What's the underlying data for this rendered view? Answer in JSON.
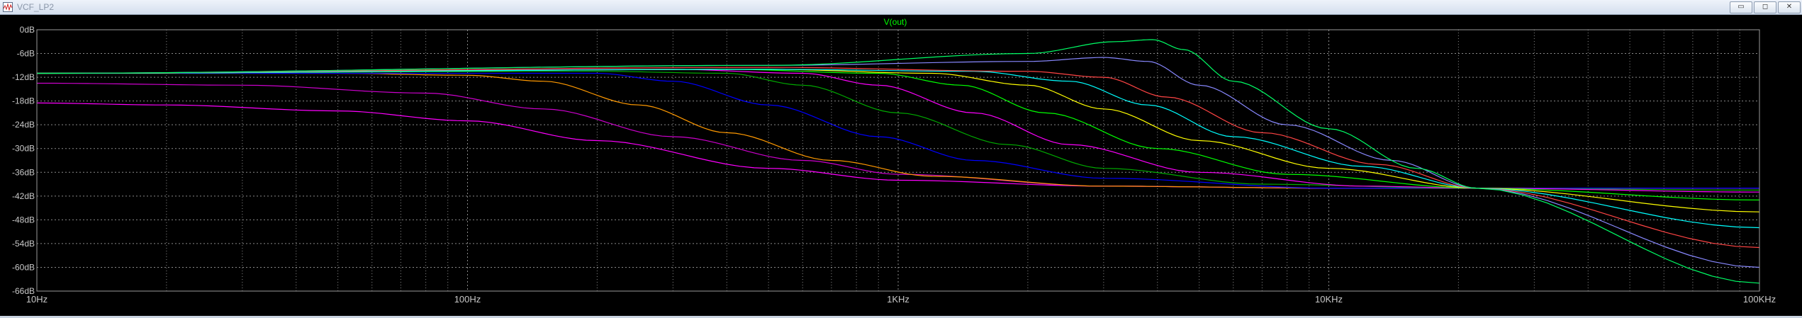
{
  "window": {
    "title": "VCF_LP2",
    "buttons": {
      "minimize": "▭",
      "maximize": "◻",
      "close": "✕"
    }
  },
  "plot": {
    "trace_label": "V(out)",
    "trace_label_color": "#00ff00",
    "background": "#000000",
    "grid_color": "#8a8a8a",
    "axis_text_color": "#c8c8c8"
  },
  "chart_data": {
    "type": "line",
    "title": "V(out)",
    "x_scale": "log",
    "xlim": [
      10,
      100000
    ],
    "ylim": [
      -66,
      0
    ],
    "grid": true,
    "x_ticks": [
      {
        "value": 10,
        "label": "10Hz"
      },
      {
        "value": 100,
        "label": "100Hz"
      },
      {
        "value": 1000,
        "label": "1KHz"
      },
      {
        "value": 10000,
        "label": "10KHz"
      },
      {
        "value": 100000,
        "label": "100KHz"
      }
    ],
    "y_ticks": [
      {
        "value": 0,
        "label": "0dB"
      },
      {
        "value": -6,
        "label": "-6dB"
      },
      {
        "value": -12,
        "label": "-12dB"
      },
      {
        "value": -18,
        "label": "-18dB"
      },
      {
        "value": -24,
        "label": "-24dB"
      },
      {
        "value": -30,
        "label": "-30dB"
      },
      {
        "value": -36,
        "label": "-36dB"
      },
      {
        "value": -42,
        "label": "-42dB"
      },
      {
        "value": -48,
        "label": "-48dB"
      },
      {
        "value": -54,
        "label": "-54dB"
      },
      {
        "value": -60,
        "label": "-60dB"
      },
      {
        "value": -66,
        "label": "-66dB"
      }
    ],
    "series": [
      {
        "color": "#ff00ff",
        "points": [
          [
            10,
            -18.5
          ],
          [
            20,
            -19
          ],
          [
            50,
            -20.5
          ],
          [
            100,
            -23
          ],
          [
            200,
            -28
          ],
          [
            500,
            -35
          ],
          [
            1000,
            -38
          ],
          [
            3000,
            -39.5
          ],
          [
            10000,
            -40
          ],
          [
            100000,
            -40
          ]
        ]
      },
      {
        "color": "#cc00cc",
        "points": [
          [
            10,
            -13.5
          ],
          [
            30,
            -14
          ],
          [
            80,
            -16
          ],
          [
            150,
            -20
          ],
          [
            300,
            -27
          ],
          [
            600,
            -33
          ],
          [
            1000,
            -36.5
          ],
          [
            3000,
            -39.5
          ],
          [
            10000,
            -40
          ],
          [
            100000,
            -40
          ]
        ]
      },
      {
        "color": "#ff9900",
        "points": [
          [
            10,
            -11
          ],
          [
            50,
            -11
          ],
          [
            100,
            -11.5
          ],
          [
            150,
            -13
          ],
          [
            250,
            -19
          ],
          [
            400,
            -26
          ],
          [
            700,
            -33
          ],
          [
            1200,
            -37
          ],
          [
            3000,
            -39.5
          ],
          [
            10000,
            -40
          ],
          [
            100000,
            -40
          ]
        ]
      },
      {
        "color": "#0000ff",
        "points": [
          [
            10,
            -11
          ],
          [
            100,
            -11
          ],
          [
            200,
            -11
          ],
          [
            300,
            -13
          ],
          [
            500,
            -19
          ],
          [
            900,
            -27
          ],
          [
            1500,
            -33
          ],
          [
            3000,
            -37.5
          ],
          [
            10000,
            -40
          ],
          [
            100000,
            -40
          ]
        ]
      },
      {
        "color": "#00aa00",
        "points": [
          [
            10,
            -11
          ],
          [
            200,
            -10.5
          ],
          [
            400,
            -11
          ],
          [
            600,
            -14
          ],
          [
            1000,
            -21
          ],
          [
            1800,
            -29
          ],
          [
            3000,
            -35
          ],
          [
            7000,
            -39
          ],
          [
            20000,
            -40
          ],
          [
            100000,
            -40.5
          ]
        ]
      },
      {
        "color": "#ff00ff",
        "points": [
          [
            10,
            -11
          ],
          [
            300,
            -10
          ],
          [
            600,
            -11
          ],
          [
            900,
            -14
          ],
          [
            1500,
            -21
          ],
          [
            2500,
            -29
          ],
          [
            5000,
            -36
          ],
          [
            12000,
            -39.5
          ],
          [
            22000,
            -40
          ],
          [
            100000,
            -41
          ]
        ]
      },
      {
        "color": "#00ff00",
        "points": [
          [
            10,
            -11
          ],
          [
            400,
            -10
          ],
          [
            900,
            -11
          ],
          [
            1400,
            -14
          ],
          [
            2200,
            -21
          ],
          [
            4000,
            -30
          ],
          [
            8000,
            -36.5
          ],
          [
            22000,
            -40
          ],
          [
            100000,
            -43
          ]
        ]
      },
      {
        "color": "#ffff00",
        "points": [
          [
            10,
            -11
          ],
          [
            500,
            -10
          ],
          [
            1200,
            -11
          ],
          [
            2000,
            -14
          ],
          [
            3000,
            -20
          ],
          [
            5000,
            -28
          ],
          [
            10000,
            -35
          ],
          [
            22000,
            -40
          ],
          [
            100000,
            -46
          ]
        ]
      },
      {
        "color": "#00ffff",
        "points": [
          [
            10,
            -11
          ],
          [
            500,
            -10
          ],
          [
            1500,
            -10.5
          ],
          [
            2500,
            -13
          ],
          [
            3800,
            -19
          ],
          [
            6000,
            -27
          ],
          [
            12000,
            -34.5
          ],
          [
            22000,
            -40
          ],
          [
            100000,
            -50
          ]
        ]
      },
      {
        "color": "#ff4444",
        "points": [
          [
            10,
            -11
          ],
          [
            500,
            -9.5
          ],
          [
            2000,
            -10.5
          ],
          [
            3000,
            -12
          ],
          [
            4200,
            -17
          ],
          [
            7000,
            -26
          ],
          [
            13000,
            -34
          ],
          [
            22000,
            -40
          ],
          [
            100000,
            -55
          ]
        ]
      },
      {
        "color": "#8888ff",
        "points": [
          [
            10,
            -11
          ],
          [
            500,
            -9
          ],
          [
            2000,
            -8
          ],
          [
            3000,
            -7
          ],
          [
            3800,
            -8
          ],
          [
            5000,
            -14
          ],
          [
            8000,
            -24
          ],
          [
            14000,
            -33
          ],
          [
            22000,
            -40
          ],
          [
            100000,
            -60
          ]
        ]
      },
      {
        "color": "#00ff66",
        "points": [
          [
            10,
            -11
          ],
          [
            500,
            -9
          ],
          [
            2000,
            -6
          ],
          [
            3200,
            -3
          ],
          [
            3900,
            -2.5
          ],
          [
            4600,
            -5
          ],
          [
            6000,
            -13
          ],
          [
            10000,
            -25
          ],
          [
            16000,
            -35
          ],
          [
            22000,
            -40
          ],
          [
            100000,
            -64
          ]
        ]
      }
    ]
  }
}
